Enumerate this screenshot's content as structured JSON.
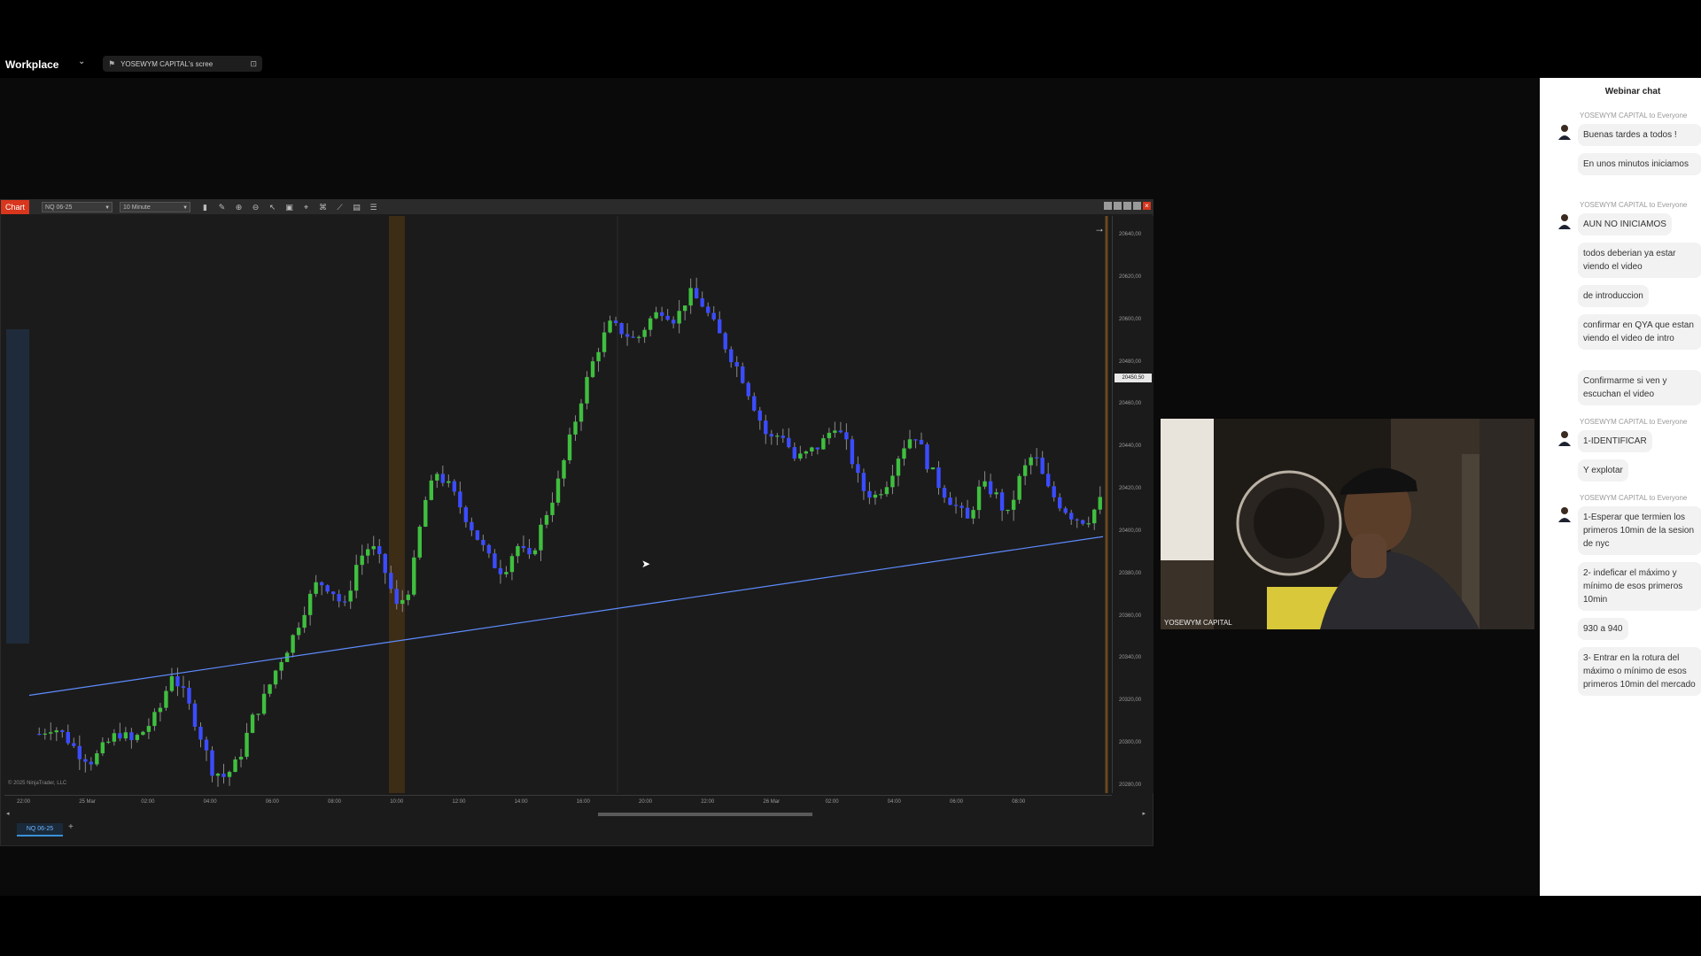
{
  "topbar": {
    "workplace_label": "Workplace",
    "share_tab_label": "YOSEWYM CAPITAL's scree"
  },
  "chart_window": {
    "badge": "Chart",
    "instrument_select": "NQ 06-25",
    "interval_select": "10 Minute",
    "copyright": "© 2025 NinjaTrader, LLC",
    "instrument_tab": "NQ 06-25",
    "last_price": "20450,50",
    "price_ticks": [
      "20640,00",
      "20620,00",
      "20600,00",
      "20480,00",
      "20460,00",
      "20440,00",
      "20420,00",
      "20400,00",
      "20380,00",
      "20360,00",
      "20340,00",
      "20320,00",
      "20300,00",
      "20280,00"
    ],
    "time_ticks": [
      "22:00",
      "25 Mar",
      "02:00",
      "04:00",
      "06:00",
      "08:00",
      "10:00",
      "12:00",
      "14:00",
      "16:00",
      "20:00",
      "22:00",
      "26 Mar",
      "02:00",
      "04:00",
      "06:00",
      "08:00"
    ],
    "colors": {
      "up": "#3fbf3f",
      "down": "#3b4cff",
      "trendline": "#5e8cff",
      "session_band": "#6b4a1e"
    }
  },
  "chart_data": {
    "type": "candlestick",
    "instrument": "NQ 06-25",
    "interval": "10 Minute",
    "ylim": [
      20280,
      20640
    ],
    "close_path": [
      20317,
      20322,
      20315,
      20305,
      20300,
      20310,
      20318,
      20312,
      20320,
      20330,
      20355,
      20340,
      20320,
      20295,
      20290,
      20300,
      20325,
      20340,
      20360,
      20375,
      20395,
      20412,
      20408,
      20395,
      20425,
      20435,
      20420,
      20395,
      20410,
      20460,
      20480,
      20470,
      20455,
      20440,
      20425,
      20418,
      20435,
      20425,
      20450,
      20470,
      20500,
      20530,
      20555,
      20572,
      20568,
      20562,
      20575,
      20582,
      20575,
      20592,
      20585,
      20570,
      20555,
      20540,
      20520,
      20500,
      20505,
      20488,
      20492,
      20498,
      20510,
      20495,
      20470,
      20465,
      20475,
      20495,
      20505,
      20485,
      20470,
      20460,
      20450,
      20472,
      20468,
      20452,
      20478,
      20492,
      20470,
      20460,
      20452,
      20450,
      20462
    ],
    "trendline": {
      "from_price": 20341,
      "to_price": 20440
    }
  },
  "webcam": {
    "name": "YOSEWYM CAPITAL"
  },
  "chat": {
    "title": "Webinar chat",
    "groups": [
      {
        "meta": "YOSEWYM CAPITAL to Everyone",
        "messages": [
          "Buenas tardes a todos !",
          "En unos minutos iniciamos"
        ]
      },
      {
        "meta": "YOSEWYM CAPITAL to Everyone",
        "messages": [
          "AUN NO INICIAMOS",
          "todos deberian ya estar viendo el video",
          "de introduccion",
          "confirmar en QYA que estan viendo el video de intro",
          "Confirmarme si ven y escuchan el video"
        ]
      },
      {
        "meta": "YOSEWYM CAPITAL to Everyone",
        "messages": [
          "1-IDENTIFICAR",
          "Y explotar"
        ]
      },
      {
        "meta": "YOSEWYM CAPITAL to Everyone",
        "messages": [
          "1-Esperar que termien los primeros 10min de la sesion de nyc",
          "2- indeficar el máximo y mínimo de esos primeros 10min",
          "930 a 940",
          "3- Entrar en la rotura del máximo o mínimo de esos primeros 10min del mercado"
        ]
      }
    ]
  }
}
